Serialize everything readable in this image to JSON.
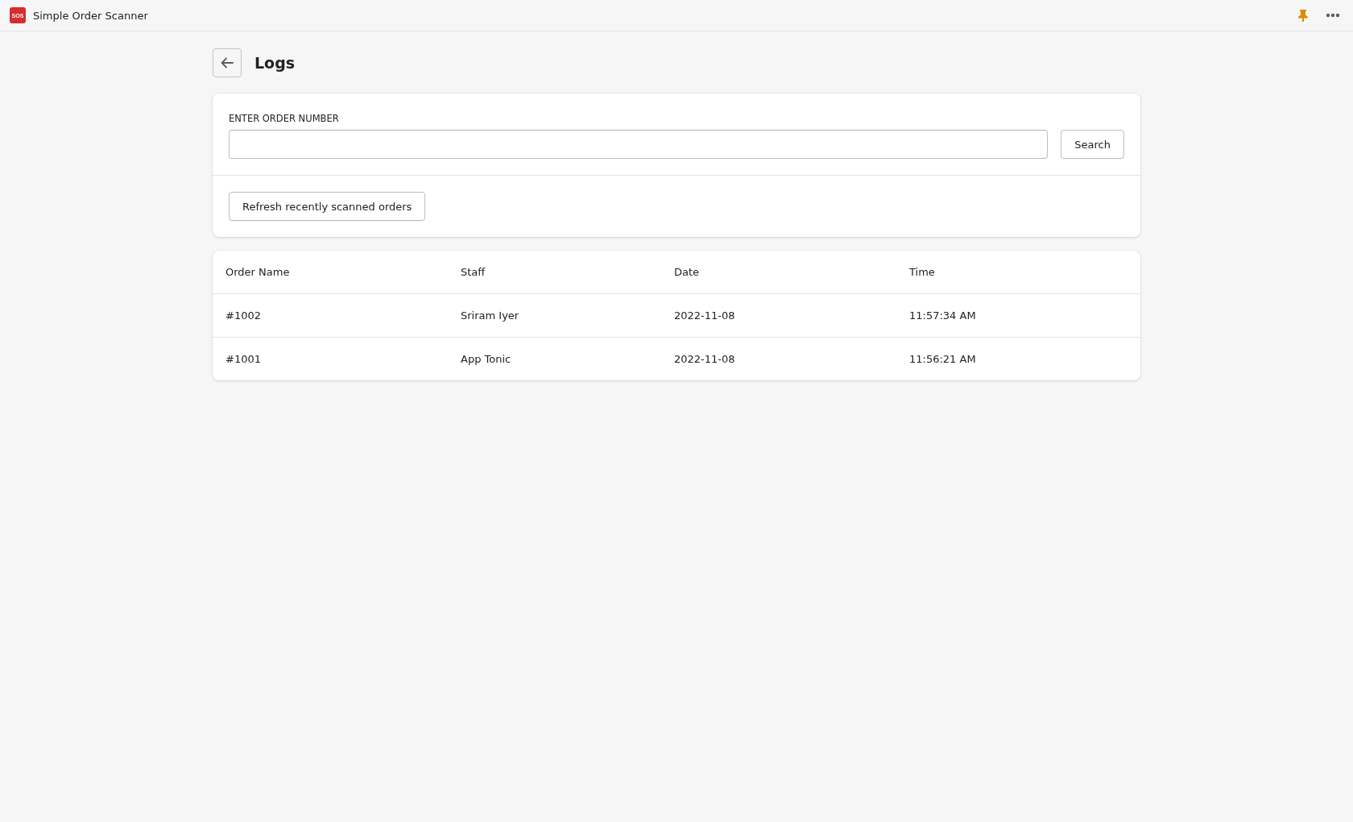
{
  "app_bar": {
    "logo_text": "SOS",
    "title": "Simple Order Scanner"
  },
  "page": {
    "title": "Logs"
  },
  "search": {
    "label": "ENTER ORDER NUMBER",
    "button": "Search"
  },
  "refresh_button": "Refresh recently scanned orders",
  "table": {
    "columns": [
      "Order Name",
      "Staff",
      "Date",
      "Time"
    ],
    "rows": [
      [
        "#1002",
        "Sriram Iyer",
        "2022-11-08",
        "11:57:34 AM"
      ],
      [
        "#1001",
        "App Tonic",
        "2022-11-08",
        "11:56:21 AM"
      ]
    ]
  }
}
